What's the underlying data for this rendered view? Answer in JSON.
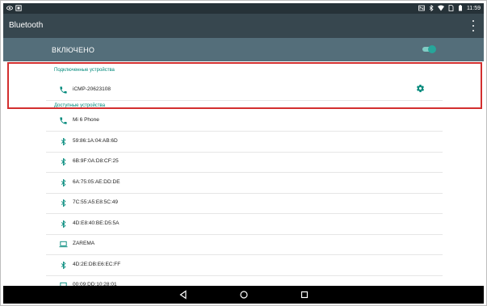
{
  "status_bar": {
    "time": "11:59",
    "left_icons": [
      "eye-icon",
      "image-icon"
    ],
    "right_icons": [
      "nfc-icon",
      "bluetooth-icon",
      "wifi-icon",
      "sim-icon",
      "battery-icon"
    ]
  },
  "app_bar": {
    "title": "Bluetooth",
    "menu_icon": "overflow-menu-icon"
  },
  "master_toggle": {
    "label": "ВКЛЮЧЕНО",
    "state": "on",
    "accent": "#26a69a"
  },
  "connected_section": {
    "header": "Подключенные устройства",
    "devices": [
      {
        "name": "iCMP-20623108",
        "icon": "phone-icon",
        "has_settings": true
      }
    ]
  },
  "available_section": {
    "header": "Доступные устройства",
    "devices": [
      {
        "name": "Mi 6 Phone",
        "icon": "phone-icon"
      },
      {
        "name": "59:86:1A:04:AB:6D",
        "icon": "bluetooth-icon"
      },
      {
        "name": "6B:9F:0A:D8:CF:25",
        "icon": "bluetooth-icon"
      },
      {
        "name": "6A:75:05:AE:DD:DE",
        "icon": "bluetooth-icon"
      },
      {
        "name": "7C:55:A5:E8:5C:49",
        "icon": "bluetooth-icon"
      },
      {
        "name": "4D:E8:40:BE:D5:5A",
        "icon": "bluetooth-icon"
      },
      {
        "name": "ZAREMA",
        "icon": "laptop-icon"
      },
      {
        "name": "4D:2E:DB:E6:EC:FF",
        "icon": "bluetooth-icon"
      },
      {
        "name": "00:09:DD:10:28:01",
        "icon": "laptop-icon"
      }
    ]
  },
  "nav_bar": {
    "buttons": [
      "back-icon",
      "home-icon",
      "recents-icon"
    ]
  },
  "colors": {
    "status_bar": "#263238",
    "app_bar": "#37474f",
    "toggle_row": "#546e7a",
    "accent": "#00897b",
    "highlight": "#d32f2f"
  }
}
